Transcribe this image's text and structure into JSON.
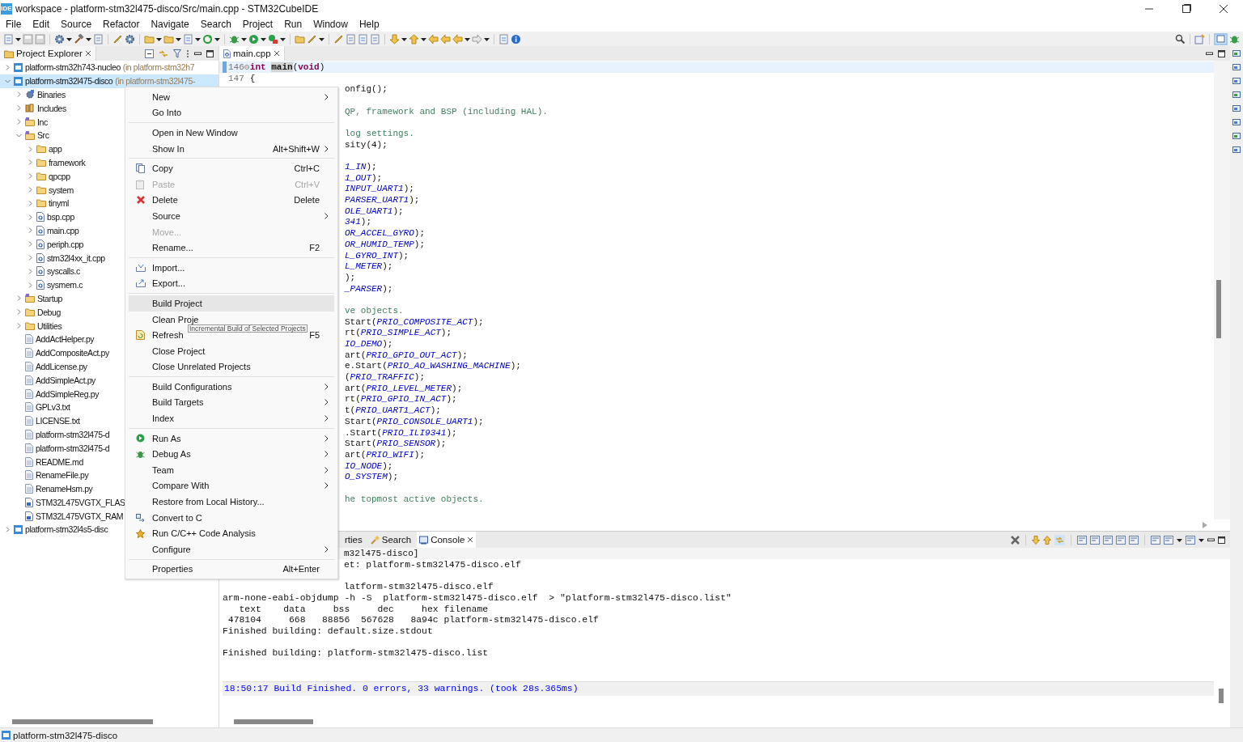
{
  "window": {
    "logo": "IDE",
    "title": "workspace - platform-stm32l475-disco/Src/main.cpp - STM32CubeIDE"
  },
  "menu": [
    "File",
    "Edit",
    "Source",
    "Refactor",
    "Navigate",
    "Search",
    "Project",
    "Run",
    "Window",
    "Help"
  ],
  "explorer": {
    "tab": "Project Explorer",
    "tree": [
      {
        "label": "platform-stm32h743-nucleo",
        "note": "(in platform-stm32h7",
        "kind": "project",
        "expanded": false,
        "selected": false
      },
      {
        "label": "platform-stm32l475-disco",
        "note": "(in platform-stm32l475-",
        "kind": "project",
        "expanded": true,
        "selected": true,
        "children": [
          {
            "label": "Binaries",
            "kind": "binaries",
            "expanded": false,
            "selected": false
          },
          {
            "label": "Includes",
            "kind": "includes",
            "expanded": false,
            "selected": false
          },
          {
            "label": "Inc",
            "kind": "source-folder",
            "expanded": false,
            "selected": false
          },
          {
            "label": "Src",
            "kind": "source-folder",
            "expanded": true,
            "selected": false,
            "children": [
              {
                "label": "app",
                "kind": "folder",
                "expanded": false,
                "selected": false
              },
              {
                "label": "framework",
                "kind": "folder",
                "expanded": false,
                "selected": false
              },
              {
                "label": "qpcpp",
                "kind": "folder",
                "expanded": false,
                "selected": false
              },
              {
                "label": "system",
                "kind": "folder",
                "expanded": false,
                "selected": false
              },
              {
                "label": "tinyml",
                "kind": "folder",
                "expanded": false,
                "selected": false
              },
              {
                "label": "bsp.cpp",
                "kind": "source-file",
                "expanded": false,
                "selected": false
              },
              {
                "label": "main.cpp",
                "kind": "source-file",
                "expanded": false,
                "selected": false
              },
              {
                "label": "periph.cpp",
                "kind": "source-file",
                "expanded": false,
                "selected": false
              },
              {
                "label": "stm32l4xx_it.cpp",
                "kind": "source-file",
                "expanded": false,
                "selected": false
              },
              {
                "label": "syscalls.c",
                "kind": "source-file",
                "expanded": false,
                "selected": false
              },
              {
                "label": "sysmem.c",
                "kind": "source-file",
                "expanded": false,
                "selected": false
              }
            ]
          },
          {
            "label": "Startup",
            "kind": "source-folder",
            "expanded": false,
            "selected": false
          },
          {
            "label": "Debug",
            "kind": "folder",
            "expanded": false,
            "selected": false
          },
          {
            "label": "Utilities",
            "kind": "folder",
            "expanded": false,
            "selected": false
          },
          {
            "label": "AddActHelper.py",
            "kind": "text-file",
            "selected": false
          },
          {
            "label": "AddCompositeAct.py",
            "kind": "text-file",
            "selected": false
          },
          {
            "label": "AddLicense.py",
            "kind": "text-file",
            "selected": false
          },
          {
            "label": "AddSimpleAct.py",
            "kind": "text-file",
            "selected": false
          },
          {
            "label": "AddSimpleReg.py",
            "kind": "text-file",
            "selected": false
          },
          {
            "label": "GPLv3.txt",
            "kind": "text-file",
            "selected": false
          },
          {
            "label": "LICENSE.txt",
            "kind": "text-file",
            "selected": false
          },
          {
            "label": "platform-stm32l475-d",
            "kind": "text-file",
            "selected": false
          },
          {
            "label": "platform-stm32l475-d",
            "kind": "text-file",
            "selected": false
          },
          {
            "label": "README.md",
            "kind": "text-file",
            "selected": false
          },
          {
            "label": "RenameFile.py",
            "kind": "text-file",
            "selected": false
          },
          {
            "label": "RenameHsm.py",
            "kind": "text-file",
            "selected": false
          },
          {
            "label": "STM32L475VGTX_FLAS",
            "kind": "linker-file",
            "selected": false
          },
          {
            "label": "STM32L475VGTX_RAM",
            "kind": "linker-file",
            "selected": false
          }
        ]
      },
      {
        "label": "platform-stm32l4s5-disc",
        "kind": "project",
        "expanded": false,
        "selected": false
      }
    ]
  },
  "editor": {
    "tab": "main.cpp",
    "lines": [
      {
        "kind": "numbered",
        "number": "146",
        "current": true,
        "segments": [
          {
            "kind": "keyword",
            "text": "int"
          },
          {
            "kind": "function",
            "text": "main"
          },
          {
            "kind": "plain",
            "text": "("
          },
          {
            "kind": "keyword",
            "text": "void"
          },
          {
            "kind": "plain",
            "text": ")"
          }
        ]
      },
      {
        "kind": "numbered",
        "number": "147",
        "current": false,
        "segments": [
          {
            "kind": "plain",
            "text": "{"
          }
        ]
      },
      {
        "kind": "covered",
        "segments": [
          {
            "kind": "plain",
            "text": "onfig();"
          }
        ]
      },
      {
        "kind": "blank"
      },
      {
        "kind": "covered",
        "segments": [
          {
            "kind": "comment",
            "text": "QP, framework and BSP (including HAL)."
          }
        ]
      },
      {
        "kind": "blank"
      },
      {
        "kind": "covered",
        "segments": [
          {
            "kind": "comment",
            "text": "log settings."
          }
        ]
      },
      {
        "kind": "covered",
        "segments": [
          {
            "kind": "plain",
            "text": "sity(4);"
          }
        ]
      },
      {
        "kind": "blank"
      },
      {
        "kind": "covered",
        "segments": [
          {
            "kind": "constant",
            "text": "1_IN"
          },
          {
            "kind": "plain",
            "text": ");"
          }
        ]
      },
      {
        "kind": "covered",
        "segments": [
          {
            "kind": "constant",
            "text": "1_OUT"
          },
          {
            "kind": "plain",
            "text": ");"
          }
        ]
      },
      {
        "kind": "covered",
        "segments": [
          {
            "kind": "constant",
            "text": "INPUT_UART1"
          },
          {
            "kind": "plain",
            "text": ");"
          }
        ]
      },
      {
        "kind": "covered",
        "segments": [
          {
            "kind": "constant",
            "text": "PARSER_UART1"
          },
          {
            "kind": "plain",
            "text": ");"
          }
        ]
      },
      {
        "kind": "covered",
        "segments": [
          {
            "kind": "constant",
            "text": "OLE_UART1"
          },
          {
            "kind": "plain",
            "text": ");"
          }
        ]
      },
      {
        "kind": "covered",
        "segments": [
          {
            "kind": "constant",
            "text": "341"
          },
          {
            "kind": "plain",
            "text": ");"
          }
        ]
      },
      {
        "kind": "covered",
        "segments": [
          {
            "kind": "constant",
            "text": "OR_ACCEL_GYRO"
          },
          {
            "kind": "plain",
            "text": ");"
          }
        ]
      },
      {
        "kind": "covered",
        "segments": [
          {
            "kind": "constant",
            "text": "OR_HUMID_TEMP"
          },
          {
            "kind": "plain",
            "text": ");"
          }
        ]
      },
      {
        "kind": "covered",
        "segments": [
          {
            "kind": "constant",
            "text": "L_GYRO_INT"
          },
          {
            "kind": "plain",
            "text": ");"
          }
        ]
      },
      {
        "kind": "covered",
        "segments": [
          {
            "kind": "constant",
            "text": "L_METER"
          },
          {
            "kind": "plain",
            "text": ");"
          }
        ]
      },
      {
        "kind": "covered",
        "segments": [
          {
            "kind": "plain",
            "text": ");"
          }
        ]
      },
      {
        "kind": "covered",
        "segments": [
          {
            "kind": "constant",
            "text": "_PARSER"
          },
          {
            "kind": "plain",
            "text": ");"
          }
        ]
      },
      {
        "kind": "blank"
      },
      {
        "kind": "covered",
        "segments": [
          {
            "kind": "comment",
            "text": "ve objects."
          }
        ]
      },
      {
        "kind": "covered",
        "segments": [
          {
            "kind": "plain",
            "text": "Start("
          },
          {
            "kind": "constant",
            "text": "PRIO_COMPOSITE_ACT"
          },
          {
            "kind": "plain",
            "text": ");"
          }
        ]
      },
      {
        "kind": "covered",
        "segments": [
          {
            "kind": "plain",
            "text": "rt("
          },
          {
            "kind": "constant",
            "text": "PRIO_SIMPLE_ACT"
          },
          {
            "kind": "plain",
            "text": ");"
          }
        ]
      },
      {
        "kind": "covered",
        "segments": [
          {
            "kind": "constant",
            "text": "IO_DEMO"
          },
          {
            "kind": "plain",
            "text": ");"
          }
        ]
      },
      {
        "kind": "covered",
        "segments": [
          {
            "kind": "plain",
            "text": "art("
          },
          {
            "kind": "constant",
            "text": "PRIO_GPIO_OUT_ACT"
          },
          {
            "kind": "plain",
            "text": ");"
          }
        ]
      },
      {
        "kind": "covered",
        "segments": [
          {
            "kind": "plain",
            "text": "e.Start("
          },
          {
            "kind": "constant",
            "text": "PRIO_AO_WASHING_MACHINE"
          },
          {
            "kind": "plain",
            "text": ");"
          }
        ]
      },
      {
        "kind": "covered",
        "segments": [
          {
            "kind": "plain",
            "text": "("
          },
          {
            "kind": "constant",
            "text": "PRIO_TRAFFIC"
          },
          {
            "kind": "plain",
            "text": ");"
          }
        ]
      },
      {
        "kind": "covered",
        "segments": [
          {
            "kind": "plain",
            "text": "art("
          },
          {
            "kind": "constant",
            "text": "PRIO_LEVEL_METER"
          },
          {
            "kind": "plain",
            "text": ");"
          }
        ]
      },
      {
        "kind": "covered",
        "segments": [
          {
            "kind": "plain",
            "text": "rt("
          },
          {
            "kind": "constant",
            "text": "PRIO_GPIO_IN_ACT"
          },
          {
            "kind": "plain",
            "text": ");"
          }
        ]
      },
      {
        "kind": "covered",
        "segments": [
          {
            "kind": "plain",
            "text": "t("
          },
          {
            "kind": "constant",
            "text": "PRIO_UART1_ACT"
          },
          {
            "kind": "plain",
            "text": ");"
          }
        ]
      },
      {
        "kind": "covered",
        "segments": [
          {
            "kind": "plain",
            "text": "Start("
          },
          {
            "kind": "constant",
            "text": "PRIO_CONSOLE_UART1"
          },
          {
            "kind": "plain",
            "text": ");"
          }
        ]
      },
      {
        "kind": "covered",
        "segments": [
          {
            "kind": "plain",
            "text": ".Start("
          },
          {
            "kind": "constant",
            "text": "PRIO_ILI9341"
          },
          {
            "kind": "plain",
            "text": ");"
          }
        ]
      },
      {
        "kind": "covered",
        "segments": [
          {
            "kind": "plain",
            "text": "Start("
          },
          {
            "kind": "constant",
            "text": "PRIO_SENSOR"
          },
          {
            "kind": "plain",
            "text": ");"
          }
        ]
      },
      {
        "kind": "covered",
        "segments": [
          {
            "kind": "plain",
            "text": "art("
          },
          {
            "kind": "constant",
            "text": "PRIO_WIFI"
          },
          {
            "kind": "plain",
            "text": ");"
          }
        ]
      },
      {
        "kind": "covered",
        "segments": [
          {
            "kind": "constant",
            "text": "IO_NODE"
          },
          {
            "kind": "plain",
            "text": ");"
          }
        ]
      },
      {
        "kind": "covered",
        "segments": [
          {
            "kind": "constant",
            "text": "O_SYSTEM"
          },
          {
            "kind": "plain",
            "text": ");"
          }
        ]
      },
      {
        "kind": "blank"
      },
      {
        "kind": "covered",
        "segments": [
          {
            "kind": "comment",
            "text": "he topmost active objects."
          }
        ]
      }
    ]
  },
  "console": {
    "tabs": [
      {
        "label": "rties",
        "kind": "properties",
        "selected": false
      },
      {
        "label": "Search",
        "kind": "search",
        "selected": false
      },
      {
        "label": "Console",
        "kind": "console",
        "selected": true
      }
    ],
    "header": "m32l475-disco]",
    "lines": [
      {
        "kind": "covered",
        "text": "et: platform-stm32l475-disco.elf"
      },
      {
        "kind": "blank"
      },
      {
        "kind": "covered",
        "text": "latform-stm32l475-disco.elf"
      },
      {
        "kind": "plain",
        "text": "arm-none-eabi-objdump -h -S  platform-stm32l475-disco.elf  > \"platform-stm32l475-disco.list\""
      },
      {
        "kind": "plain",
        "text": "   text    data     bss     dec     hex filename"
      },
      {
        "kind": "plain",
        "text": " 478104     668   88856  567628   8a94c platform-stm32l475-disco.elf"
      },
      {
        "kind": "plain",
        "text": "Finished building: default.size.stdout"
      },
      {
        "kind": "blank"
      },
      {
        "kind": "plain",
        "text": "Finished building: platform-stm32l475-disco.list"
      },
      {
        "kind": "blank"
      },
      {
        "kind": "blank"
      },
      {
        "kind": "status",
        "text": "18:50:17 Build Finished. 0 errors, 33 warnings. (took 28s.365ms)"
      }
    ]
  },
  "context_menu": {
    "items": [
      {
        "kind": "plain",
        "label": "New",
        "submenu": true,
        "disabled": false,
        "selected": false
      },
      {
        "kind": "plain",
        "label": "Go Into",
        "submenu": false,
        "disabled": false,
        "selected": false
      },
      {
        "kind": "separator"
      },
      {
        "kind": "plain",
        "label": "Open in New Window",
        "submenu": false,
        "disabled": false,
        "selected": false
      },
      {
        "kind": "plain",
        "label": "Show In",
        "shortcut": "Alt+Shift+W",
        "submenu": true,
        "disabled": false,
        "selected": false
      },
      {
        "kind": "separator"
      },
      {
        "kind": "copy",
        "label": "Copy",
        "shortcut": "Ctrl+C",
        "submenu": false,
        "disabled": false,
        "selected": false
      },
      {
        "kind": "paste",
        "label": "Paste",
        "shortcut": "Ctrl+V",
        "submenu": false,
        "disabled": true,
        "selected": false
      },
      {
        "kind": "delete",
        "label": "Delete",
        "shortcut": "Delete",
        "submenu": false,
        "disabled": false,
        "selected": false
      },
      {
        "kind": "plain",
        "label": "Source",
        "submenu": true,
        "disabled": false,
        "selected": false
      },
      {
        "kind": "plain",
        "label": "Move...",
        "submenu": false,
        "disabled": true,
        "selected": false
      },
      {
        "kind": "plain",
        "label": "Rename...",
        "shortcut": "F2",
        "submenu": false,
        "disabled": false,
        "selected": false
      },
      {
        "kind": "separator"
      },
      {
        "kind": "import",
        "label": "Import...",
        "submenu": false,
        "disabled": false,
        "selected": false
      },
      {
        "kind": "export",
        "label": "Export...",
        "submenu": false,
        "disabled": false,
        "selected": false
      },
      {
        "kind": "separator"
      },
      {
        "kind": "plain",
        "label": "Build Project",
        "submenu": false,
        "disabled": false,
        "selected": true
      },
      {
        "kind": "plain",
        "label": "Clean Proje",
        "submenu": false,
        "disabled": false,
        "selected": false
      },
      {
        "kind": "refresh",
        "label": "Refresh",
        "shortcut": "F5",
        "submenu": false,
        "disabled": false,
        "selected": false
      },
      {
        "kind": "plain",
        "label": "Close Project",
        "submenu": false,
        "disabled": false,
        "selected": false
      },
      {
        "kind": "plain",
        "label": "Close Unrelated Projects",
        "submenu": false,
        "disabled": false,
        "selected": false
      },
      {
        "kind": "separator"
      },
      {
        "kind": "plain",
        "label": "Build Configurations",
        "submenu": true,
        "disabled": false,
        "selected": false
      },
      {
        "kind": "plain",
        "label": "Build Targets",
        "submenu": true,
        "disabled": false,
        "selected": false
      },
      {
        "kind": "plain",
        "label": "Index",
        "submenu": true,
        "disabled": false,
        "selected": false
      },
      {
        "kind": "separator"
      },
      {
        "kind": "run",
        "label": "Run As",
        "submenu": true,
        "disabled": false,
        "selected": false
      },
      {
        "kind": "debug",
        "label": "Debug As",
        "submenu": true,
        "disabled": false,
        "selected": false
      },
      {
        "kind": "plain",
        "label": "Team",
        "submenu": true,
        "disabled": false,
        "selected": false
      },
      {
        "kind": "plain",
        "label": "Compare With",
        "submenu": true,
        "disabled": false,
        "selected": false
      },
      {
        "kind": "plain",
        "label": "Restore from Local History...",
        "submenu": false,
        "disabled": false,
        "selected": false
      },
      {
        "kind": "convert",
        "label": "Convert to C",
        "submenu": false,
        "disabled": false,
        "selected": false
      },
      {
        "kind": "analysis",
        "label": "Run C/C++ Code Analysis",
        "submenu": false,
        "disabled": false,
        "selected": false
      },
      {
        "kind": "plain",
        "label": "Configure",
        "submenu": true,
        "disabled": false,
        "selected": false
      },
      {
        "kind": "separator"
      },
      {
        "kind": "plain",
        "label": "Properties",
        "shortcut": "Alt+Enter",
        "submenu": false,
        "disabled": false,
        "selected": false
      }
    ]
  },
  "tooltip": "Incremental Build of Selected Projects",
  "status_bar": {
    "text": "platform-stm32l475-disco"
  }
}
